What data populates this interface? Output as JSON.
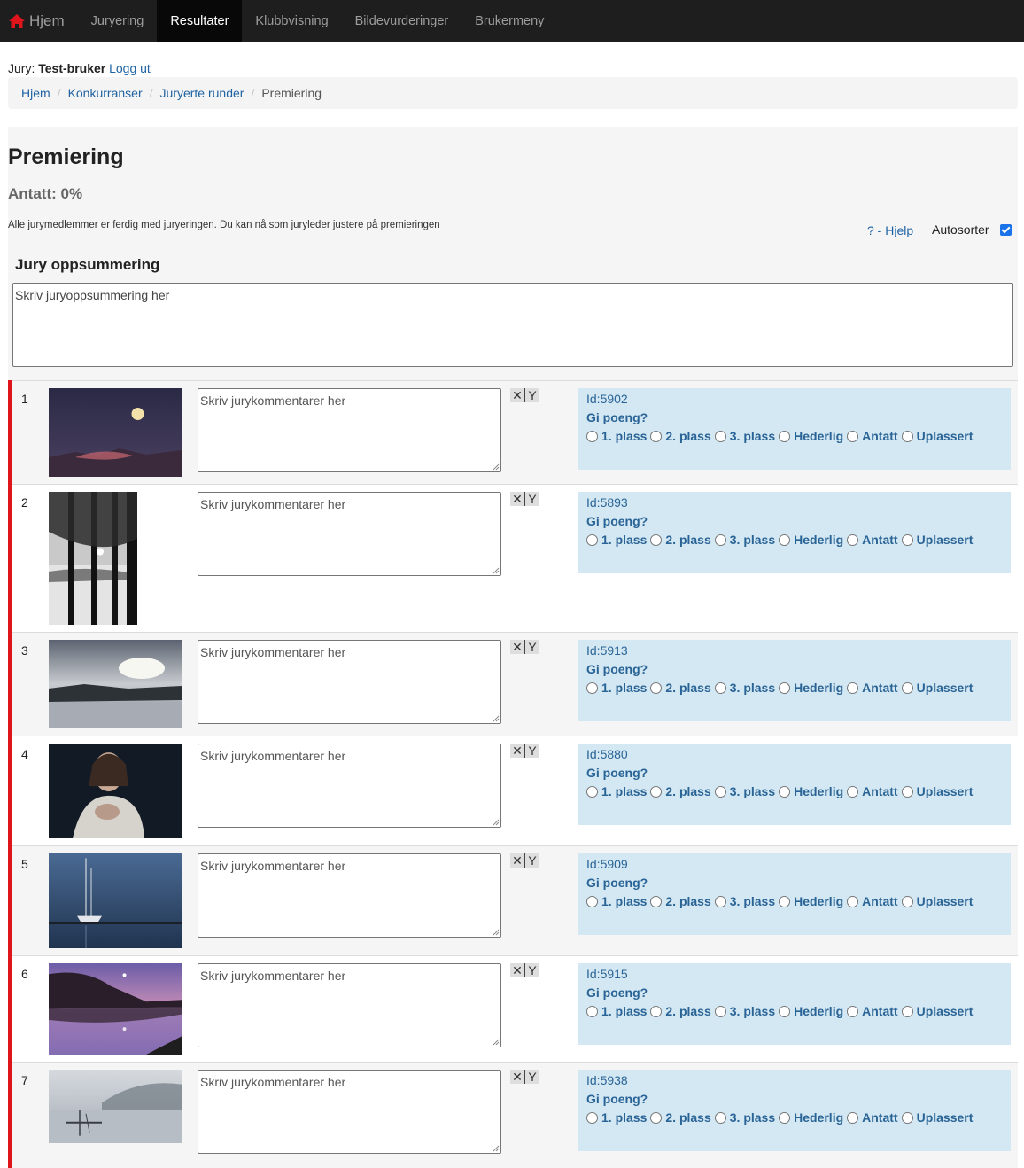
{
  "nav": {
    "brand": "Hjem",
    "items": [
      {
        "label": "Juryering",
        "active": false
      },
      {
        "label": "Resultater",
        "active": true
      },
      {
        "label": "Klubbvisning",
        "active": false
      },
      {
        "label": "Bildevurderinger",
        "active": false
      },
      {
        "label": "Brukermeny",
        "active": false
      }
    ],
    "brand_icon_color": "#e0151b"
  },
  "user": {
    "prefix": "Jury:",
    "name": "Test-bruker",
    "logout": "Logg ut"
  },
  "breadcrumb": {
    "items": [
      "Hjem",
      "Konkurranser",
      "Juryerte runder"
    ],
    "current": "Premiering"
  },
  "page": {
    "title": "Premiering",
    "status": "Antatt: 0%",
    "notice": "Alle jurymedlemmer er ferdig med juryeringen. Du kan nå som juryleder justere på premieringen",
    "help": "? - Hjelp",
    "autosort_label": "Autosorter",
    "autosort_checked": true,
    "summary_heading": "Jury oppsummering",
    "summary_placeholder": "Skriv juryoppsummering her"
  },
  "labels": {
    "comment_placeholder": "Skriv jurykommentarer her",
    "btn_x": "✕",
    "btn_y": "Y",
    "question": "Gi poeng?",
    "options": [
      "1. plass",
      "2. plass",
      "3. plass",
      "Hederlig",
      "Antatt",
      "Uplassert"
    ]
  },
  "entries": [
    {
      "num": "1",
      "id": "Id:5902",
      "image": "moon-over-mountains"
    },
    {
      "num": "2",
      "id": "Id:5893",
      "image": "trees-winter-lake"
    },
    {
      "num": "3",
      "id": "Id:5913",
      "image": "cloudy-lake"
    },
    {
      "num": "4",
      "id": "Id:5880",
      "image": "portrait-woman"
    },
    {
      "num": "5",
      "id": "Id:5909",
      "image": "sailboat-dusk"
    },
    {
      "num": "6",
      "id": "Id:5915",
      "image": "purple-lake-moon"
    },
    {
      "num": "7",
      "id": "Id:5938",
      "image": "foggy-lake"
    }
  ],
  "colors": {
    "accent": "#e0151b",
    "link": "#1f63a3",
    "vote_bg": "#d3e8f3"
  }
}
